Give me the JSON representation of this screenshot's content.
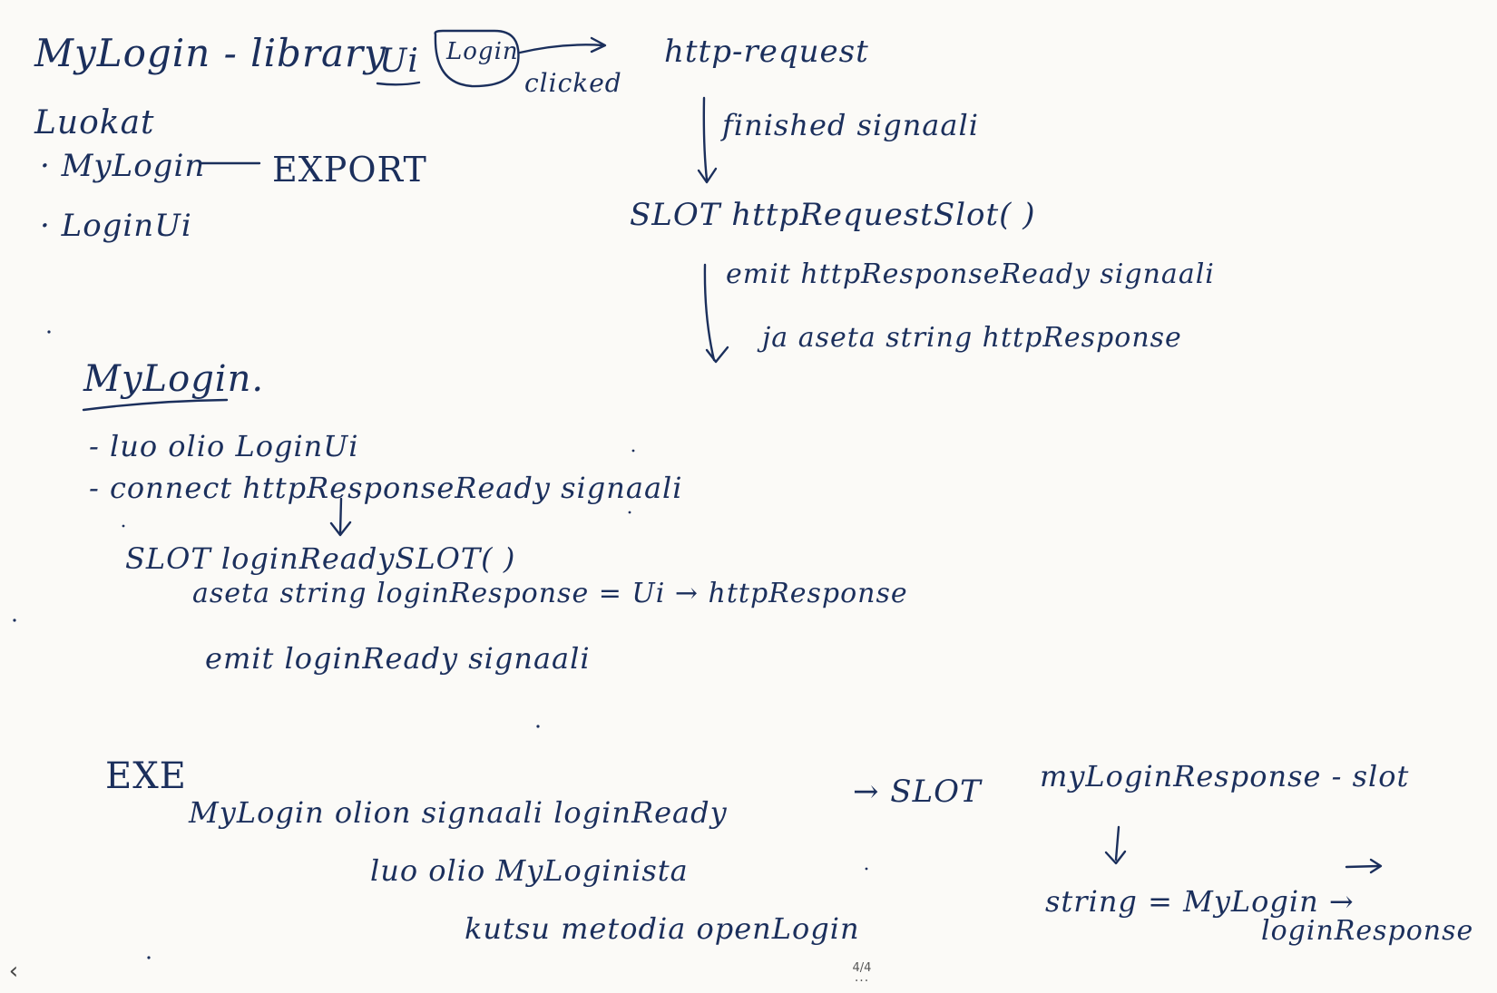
{
  "notes": {
    "library_title": "MyLogin - library",
    "ui_label": "Ui",
    "login_button": "Login",
    "clicked": "clicked",
    "classes_heading": "Luokat",
    "class_mylogin": "· MyLogin",
    "export": "EXPORT",
    "class_loginui": "· LoginUi",
    "http_request": "http-request",
    "finished_signal": "finished signaali",
    "slot_http": "SLOT httpRequestSlot( )",
    "emit_http": "emit httpResponseReady signaali",
    "set_http_string": "ja aseta string httpResponse",
    "mylogin_heading": "MyLogin.",
    "create_object": "- luo olio LoginUi",
    "connect_signal": "- connect httpResponseReady signaali",
    "slot_login": "SLOT loginReadySLOT( )",
    "set_login_string": "aseta string loginResponse = Ui → httpResponse",
    "emit_login": "emit loginReady signaali",
    "exe_heading": "EXE",
    "exe_signal": "MyLogin olion signaali loginReady",
    "exe_slot": "→ SLOT",
    "exe_slot_name": "myLoginResponse - slot",
    "create_instance": "luo olio MyLoginista",
    "call_method": "kutsu metodia openLogin",
    "string_assign": "string = MyLogin →",
    "login_response": "loginResponse"
  },
  "viewer": {
    "prev_icon": "‹",
    "page_indicator": "4/4",
    "more_icon": "···"
  }
}
